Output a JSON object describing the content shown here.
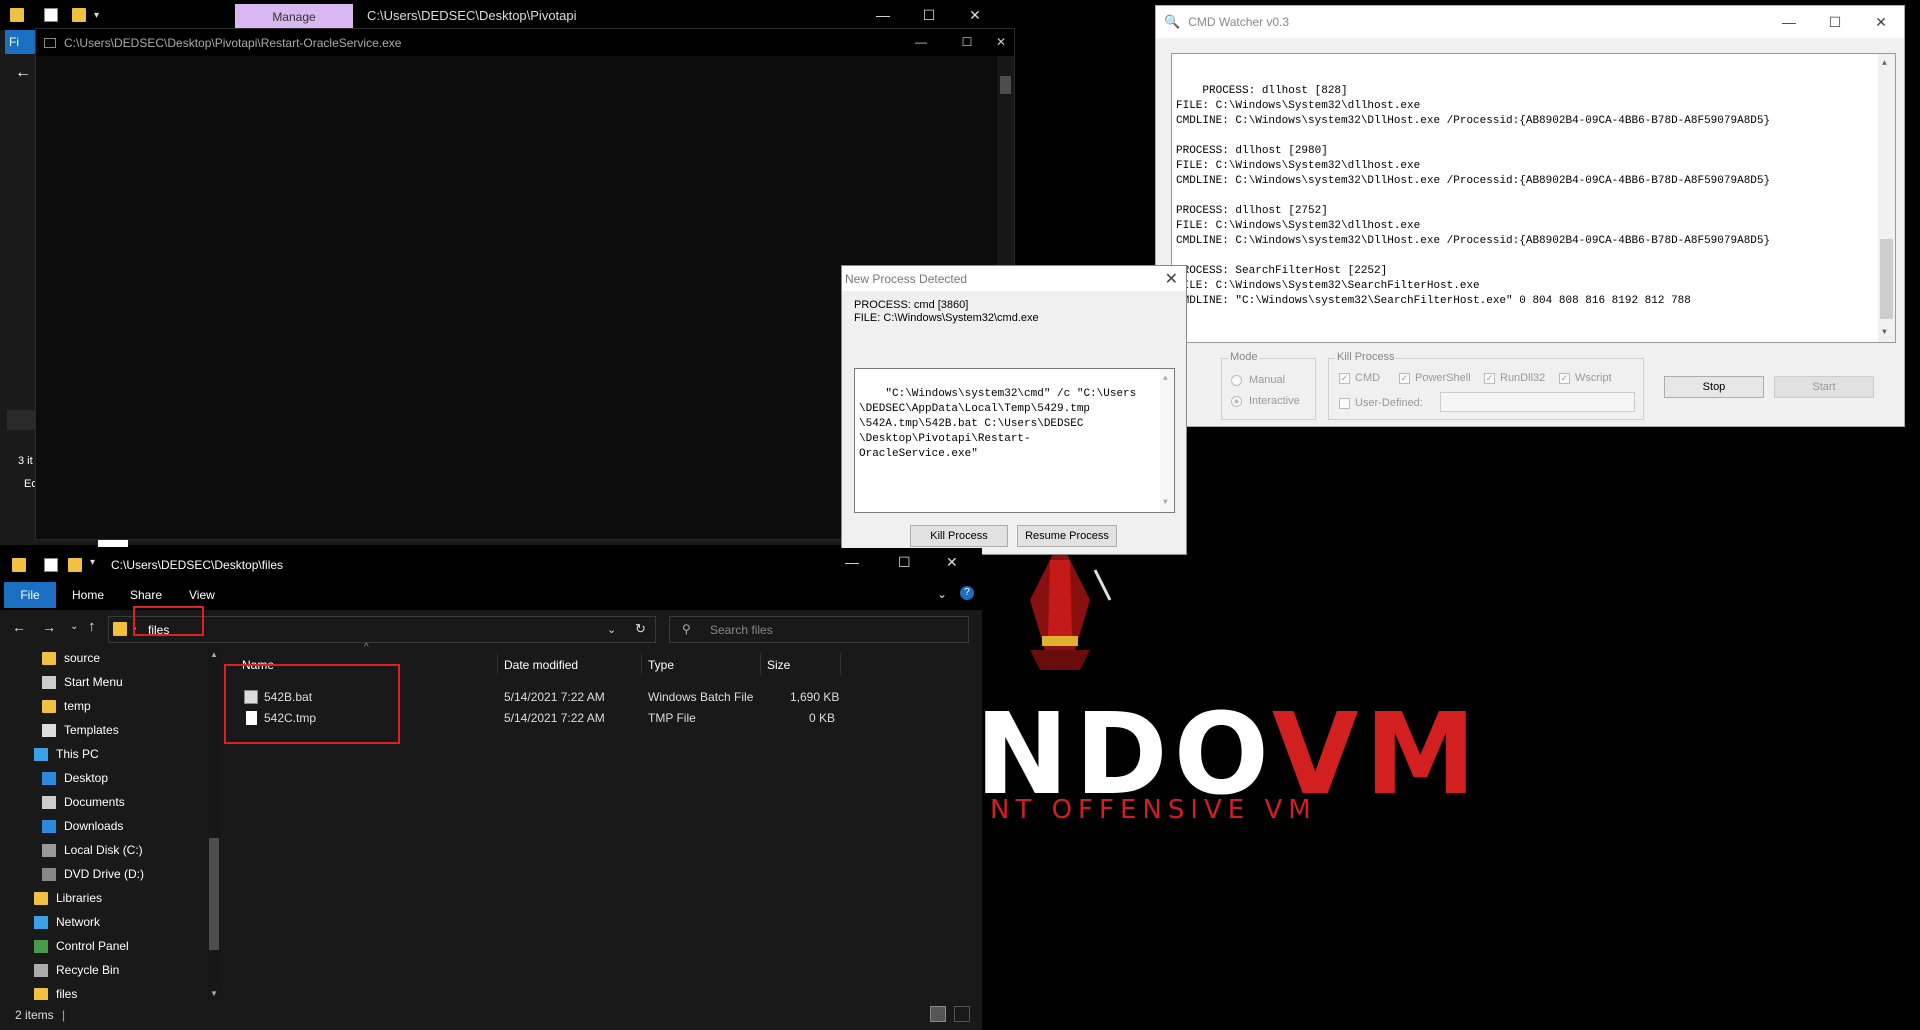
{
  "wallpaper": {
    "logo_part1": "NDO",
    "logo_part2": "VM",
    "subtitle": "NT OFFENSIVE VM"
  },
  "explorer_back": {
    "manage_tab": "Manage",
    "path": "C:\\Users\\DEDSEC\\Desktop\\Pivotapi",
    "ribbon_file": "Fi",
    "status": "3 it",
    "edge_text": "Ec"
  },
  "console": {
    "title": "C:\\Users\\DEDSEC\\Desktop\\Pivotapi\\Restart-OracleService.exe"
  },
  "npd": {
    "title": "New Process Detected",
    "process": "PROCESS: cmd [3860]",
    "file": "FILE: C:\\Windows\\System32\\cmd.exe",
    "cmdline": "\"C:\\Windows\\system32\\cmd\" /c \"C:\\Users\n\\DEDSEC\\AppData\\Local\\Temp\\5429.tmp\n\\542A.tmp\\542B.bat C:\\Users\\DEDSEC\n\\Desktop\\Pivotapi\\Restart-\nOracleService.exe\"",
    "kill_button": "Kill Process",
    "resume_button": "Resume Process"
  },
  "cmdwatcher": {
    "title": "CMD Watcher v0.3",
    "log": "PROCESS: dllhost [828]\nFILE: C:\\Windows\\System32\\dllhost.exe\nCMDLINE: C:\\Windows\\system32\\DllHost.exe /Processid:{AB8902B4-09CA-4BB6-B78D-A8F59079A8D5}\n\nPROCESS: dllhost [2980]\nFILE: C:\\Windows\\System32\\dllhost.exe\nCMDLINE: C:\\Windows\\system32\\DllHost.exe /Processid:{AB8902B4-09CA-4BB6-B78D-A8F59079A8D5}\n\nPROCESS: dllhost [2752]\nFILE: C:\\Windows\\System32\\dllhost.exe\nCMDLINE: C:\\Windows\\system32\\DllHost.exe /Processid:{AB8902B4-09CA-4BB6-B78D-A8F59079A8D5}\n\nPROCESS: SearchFilterHost [2252]\nFILE: C:\\Windows\\System32\\SearchFilterHost.exe\nCMDLINE: \"C:\\Windows\\system32\\SearchFilterHost.exe\" 0 804 808 816 8192 812 788",
    "mode_label": "Mode",
    "mode_manual": "Manual",
    "mode_interactive": "Interactive",
    "kill_label": "Kill Process",
    "kill_cmd": "CMD",
    "kill_powershell": "PowerShell",
    "kill_rundll32": "RunDll32",
    "kill_wscript": "Wscript",
    "user_defined": "User-Defined:",
    "stop_button": "Stop",
    "start_button": "Start"
  },
  "explorer": {
    "title": "C:\\Users\\DEDSEC\\Desktop\\files",
    "tabs": [
      "File",
      "Home",
      "Share",
      "View"
    ],
    "address": "files",
    "search_placeholder": "Search files",
    "nav": [
      "source",
      "Start Menu",
      "temp",
      "Templates",
      "This PC",
      "Desktop",
      "Documents",
      "Downloads",
      "Local Disk (C:)",
      "DVD Drive (D:)",
      "Libraries",
      "Network",
      "Control Panel",
      "Recycle Bin",
      "files"
    ],
    "columns": [
      "Name",
      "Date modified",
      "Type",
      "Size"
    ],
    "files": [
      {
        "name": "542B.bat",
        "date": "5/14/2021 7:22 AM",
        "type": "Windows Batch File",
        "size": "1,690 KB"
      },
      {
        "name": "542C.tmp",
        "date": "5/14/2021 7:22 AM",
        "type": "TMP File",
        "size": "0 KB"
      }
    ],
    "status": "2 items"
  }
}
